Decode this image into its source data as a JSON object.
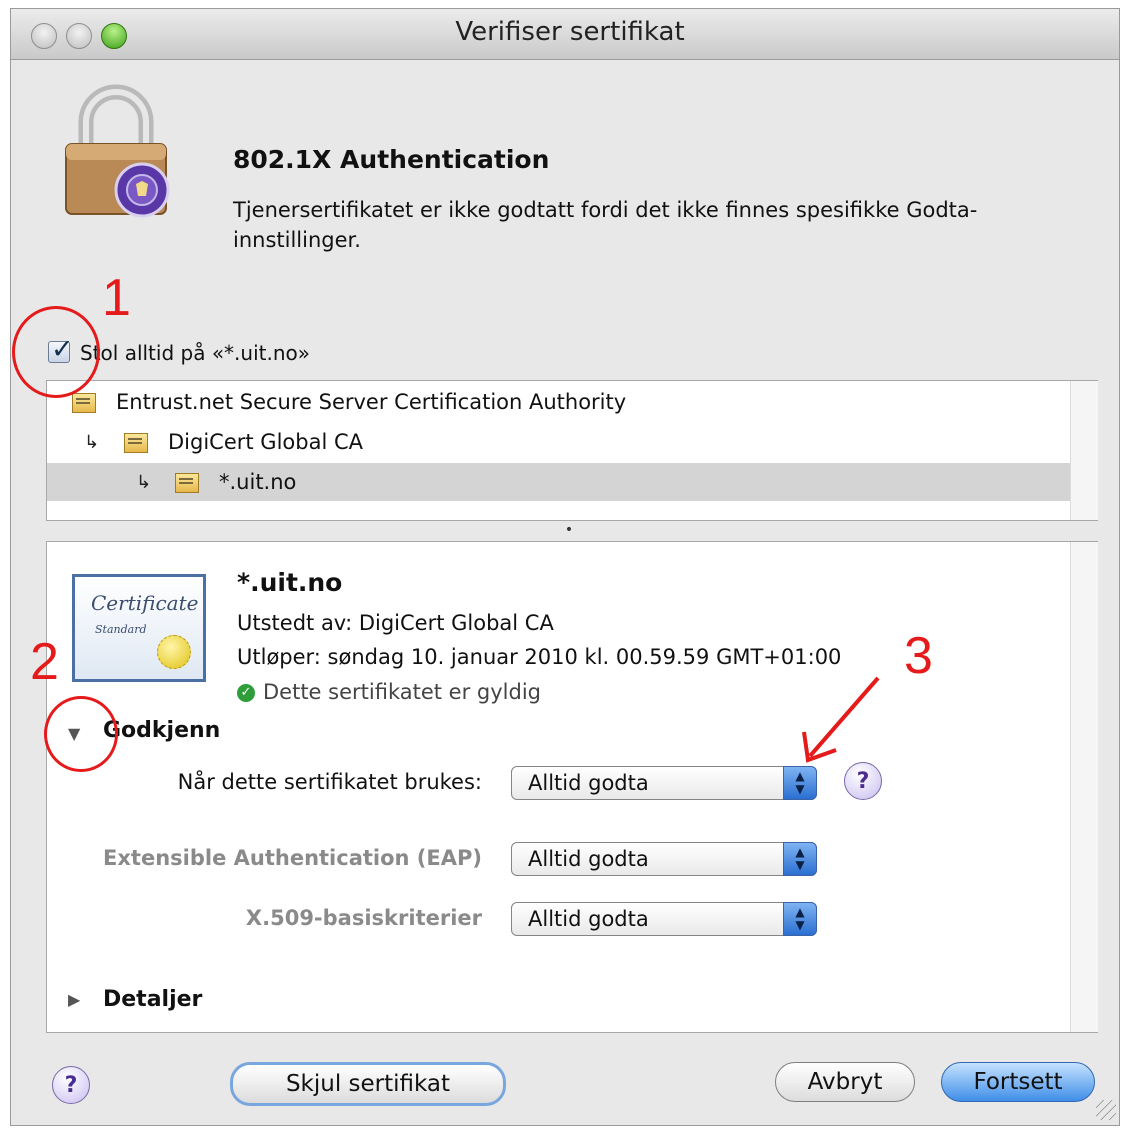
{
  "window": {
    "title": "Verifiser sertifikat"
  },
  "header": {
    "title": "802.1X Authentication",
    "message": "Tjenersertifikatet er ikke godtatt fordi det ikke finnes spesifikke Godta-innstillinger."
  },
  "trust_checkbox": {
    "label": "Stol alltid på «*.uit.no»",
    "checked": true
  },
  "chain": [
    {
      "label": "Entrust.net Secure Server Certification Authority"
    },
    {
      "label": "DigiCert Global CA"
    },
    {
      "label": "*.uit.no",
      "selected": true
    }
  ],
  "certificate": {
    "name": "*.uit.no",
    "issuer": "Utstedt av: DigiCert Global CA",
    "expiry": "Utløper: søndag 10. januar 2010 kl. 00.59.59 GMT+01:00",
    "status": "Dette sertifikatet er gyldig",
    "image_script": "Certificate",
    "image_subtitle": "Standard"
  },
  "trust_section": {
    "heading": "Godkjenn",
    "rows": [
      {
        "label": "Når dette sertifikatet brukes:",
        "value": "Alltid godta"
      },
      {
        "label": "Extensible Authentication (EAP)",
        "value": "Alltid godta"
      },
      {
        "label": "X.509-basiskriterier",
        "value": "Alltid godta"
      }
    ]
  },
  "details_section": {
    "heading": "Detaljer"
  },
  "buttons": {
    "help": "?",
    "show_certificate": "Skjul sertifikat",
    "cancel": "Avbryt",
    "continue": "Fortsett"
  },
  "annotations": [
    "1",
    "2",
    "3"
  ],
  "colors": {
    "annotation": "#e51b1b",
    "default_button": "#3f8ee8",
    "valid": "#2f9e3a"
  }
}
